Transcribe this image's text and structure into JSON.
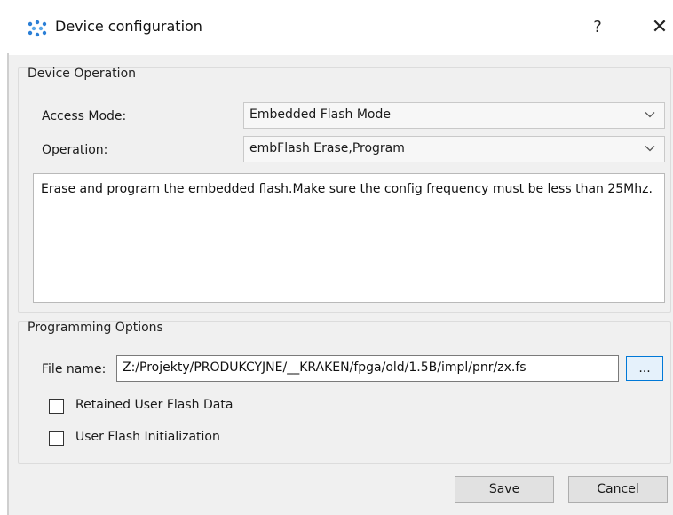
{
  "window": {
    "title": "Device configuration",
    "help_label": "?",
    "close_label": "✕"
  },
  "device_operation": {
    "group_title": "Device Operation",
    "access_mode_label": "Access Mode:",
    "access_mode_value": "Embedded Flash Mode",
    "operation_label": "Operation:",
    "operation_value": "embFlash Erase,Program",
    "description": "Erase and program the embedded flash.Make sure the config frequency must be less than 25Mhz."
  },
  "programming_options": {
    "group_title": "Programming Options",
    "file_name_label": "File name:",
    "file_name_value": "Z:/Projekty/PRODUKCYJNE/__KRAKEN/fpga/old/1.5B/impl/pnr/zx.fs",
    "browse_label": "...",
    "retained_user_flash_label": "Retained User Flash Data",
    "retained_user_flash_checked": false,
    "user_flash_init_label": "User Flash Initialization",
    "user_flash_init_checked": false
  },
  "buttons": {
    "save_label": "Save",
    "cancel_label": "Cancel"
  },
  "colors": {
    "accent": "#0078d7",
    "dialog_bg": "#f0f0f0",
    "icon_blue": "#2b7fd6"
  }
}
